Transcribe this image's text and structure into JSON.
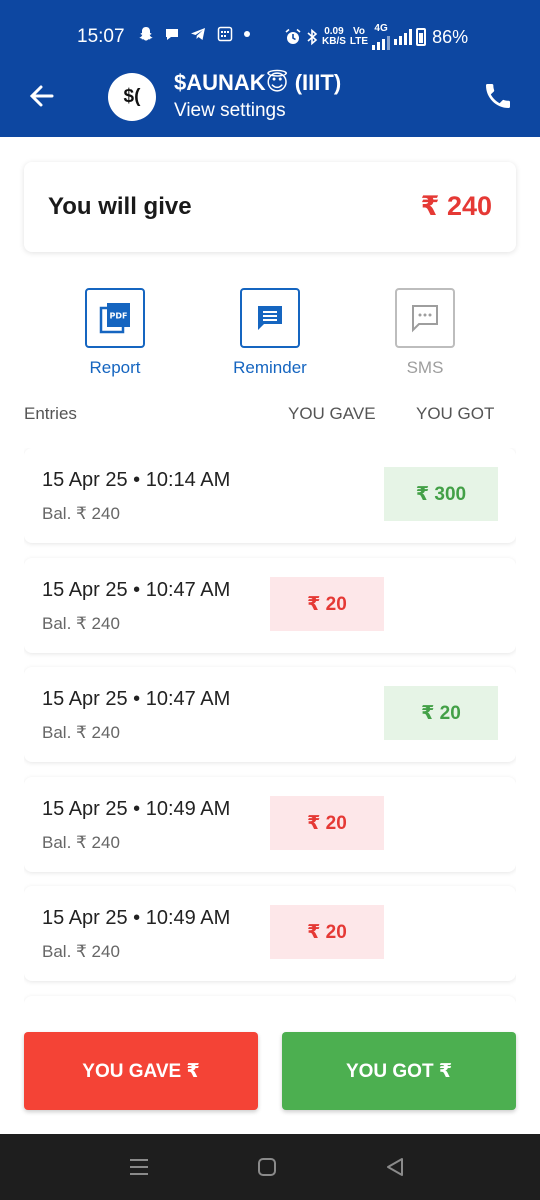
{
  "status_bar": {
    "time": "15:07",
    "net_speed_value": "0.09",
    "net_speed_unit": "KB/S",
    "net_type_top": "Vo",
    "net_type_bottom": "LTE",
    "net_gen": "4G",
    "battery": "86%"
  },
  "header": {
    "avatar_text": "$(",
    "contact_name": "$AUNAK😇 (IIIT)",
    "subtitle": "View settings"
  },
  "summary": {
    "label": "You will give",
    "amount": "₹ 240",
    "amount_color": "#e53935"
  },
  "actions": [
    {
      "label": "Report",
      "icon": "pdf-report-icon",
      "enabled": true
    },
    {
      "label": "Reminder",
      "icon": "reminder-message-icon",
      "enabled": true
    },
    {
      "label": "SMS",
      "icon": "sms-icon",
      "enabled": false
    }
  ],
  "list_header": {
    "entries": "Entries",
    "you_gave": "YOU GAVE",
    "you_got": "YOU GOT"
  },
  "entries": [
    {
      "date": "15 Apr 25 • 10:14 AM",
      "balance": "Bal. ₹ 240",
      "gave": "",
      "got": "₹ 300"
    },
    {
      "date": "15 Apr 25 • 10:47 AM",
      "balance": "Bal. ₹ 240",
      "gave": "₹ 20",
      "got": ""
    },
    {
      "date": "15 Apr 25 • 10:47 AM",
      "balance": "Bal. ₹ 240",
      "gave": "",
      "got": "₹ 20"
    },
    {
      "date": "15 Apr 25 • 10:49 AM",
      "balance": "Bal. ₹ 240",
      "gave": "₹ 20",
      "got": ""
    },
    {
      "date": "15 Apr 25 • 10:49 AM",
      "balance": "Bal. ₹ 240",
      "gave": "₹ 20",
      "got": ""
    }
  ],
  "bottom_buttons": {
    "you_gave": "YOU GAVE ₹",
    "you_got": "YOU GOT ₹"
  },
  "colors": {
    "brand_blue": "#0d47a1",
    "gave_red": "#f44336",
    "got_green": "#4caf50"
  }
}
